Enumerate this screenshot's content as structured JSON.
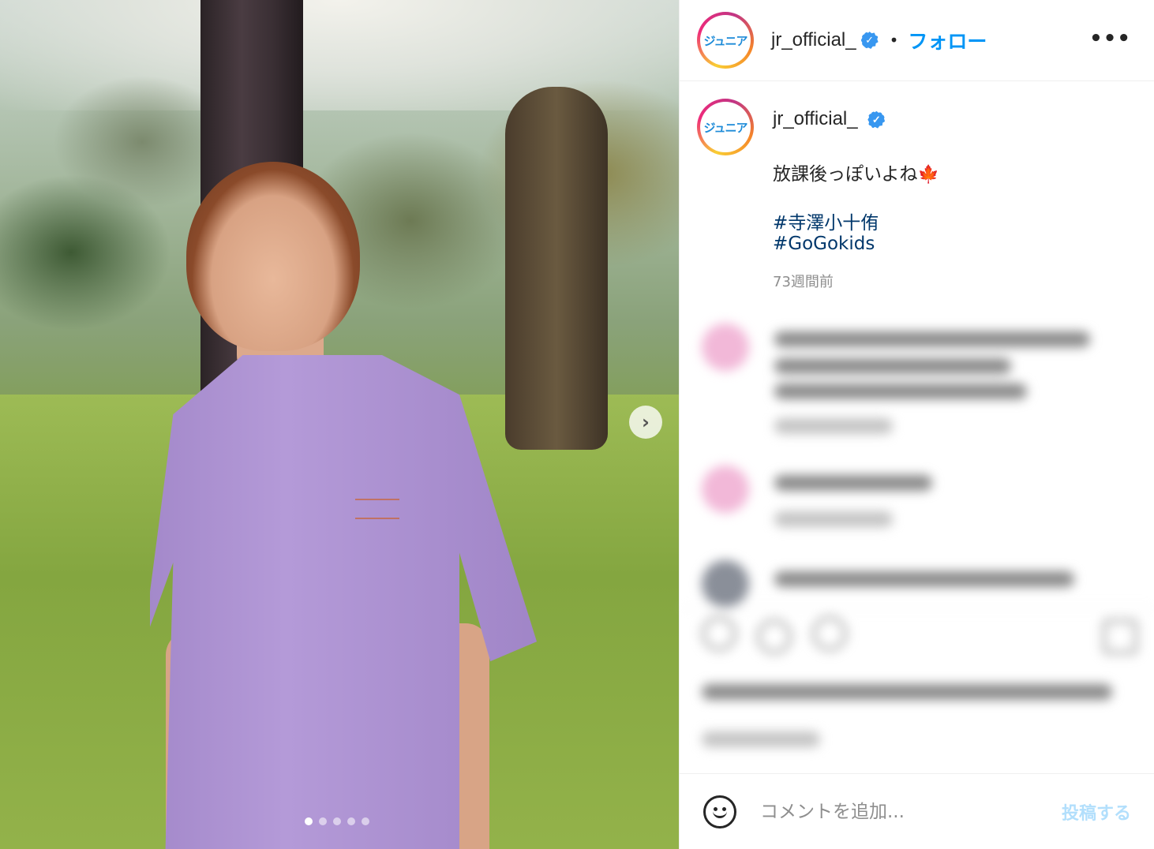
{
  "post": {
    "image_count": 5,
    "active_image_index": 0
  },
  "account": {
    "avatar_logo_text": "ジュニア",
    "username": "jr_official_",
    "verified": true
  },
  "header": {
    "separator": "•",
    "follow_label": "フォロー",
    "more_icon": "more-horizontal-icon"
  },
  "caption": {
    "text": "放課後っぽいよね",
    "emoji": "🍁",
    "hashtags": [
      "#寺澤小十侑",
      "#GoGokids"
    ],
    "time_ago": "73週間前"
  },
  "media_nav": {
    "next_icon": "chevron-right-icon",
    "next_glyph": "›"
  },
  "comment_bar": {
    "emoji_icon": "smiley-icon",
    "placeholder": "コメントを追加...",
    "post_label": "投稿する"
  },
  "colors": {
    "accent": "#0095f6",
    "hashtag": "#00376b",
    "verified": "#3897f0",
    "post_disabled": "#b2dffc",
    "time": "#8e8e8e"
  }
}
